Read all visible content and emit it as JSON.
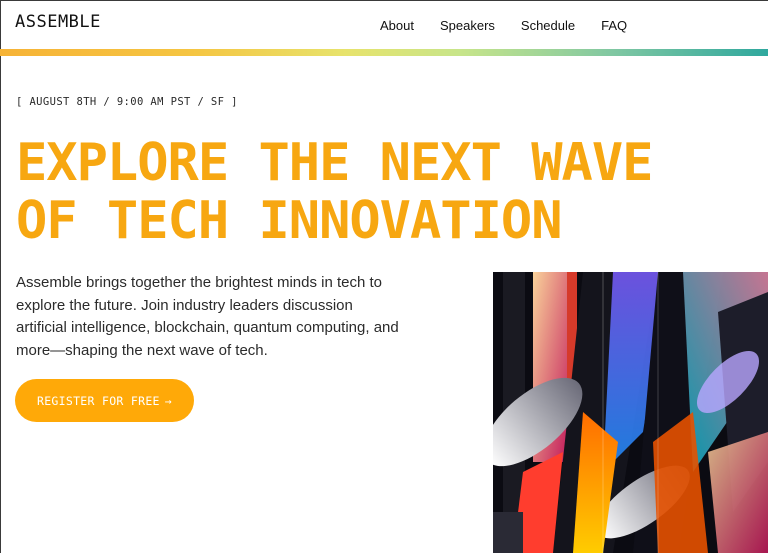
{
  "header": {
    "logo": "ASSEMBLE",
    "nav": [
      {
        "label": "About"
      },
      {
        "label": "Speakers"
      },
      {
        "label": "Schedule"
      },
      {
        "label": "FAQ"
      }
    ]
  },
  "hero": {
    "eyebrow": "[ AUGUST 8TH / 9:00 AM PST / SF ]",
    "headline_line1": "EXPLORE THE NEXT WAVE",
    "headline_line2": "OF TECH INNOVATION",
    "intro_line1": "Assemble brings together the brightest minds in tech to",
    "intro_line2": "explore the future. Join industry leaders discussion",
    "intro_line3": "artificial intelligence, blockchain, quantum computing, and",
    "intro_line4": "more—shaping the next wave of tech.",
    "cta_label": "REGISTER FOR FREE",
    "cta_icon": "→"
  },
  "colors": {
    "accent": "#f7a711",
    "button": "#ffa908",
    "gradient_start": "#f6b336",
    "gradient_end": "#2fa89e"
  }
}
